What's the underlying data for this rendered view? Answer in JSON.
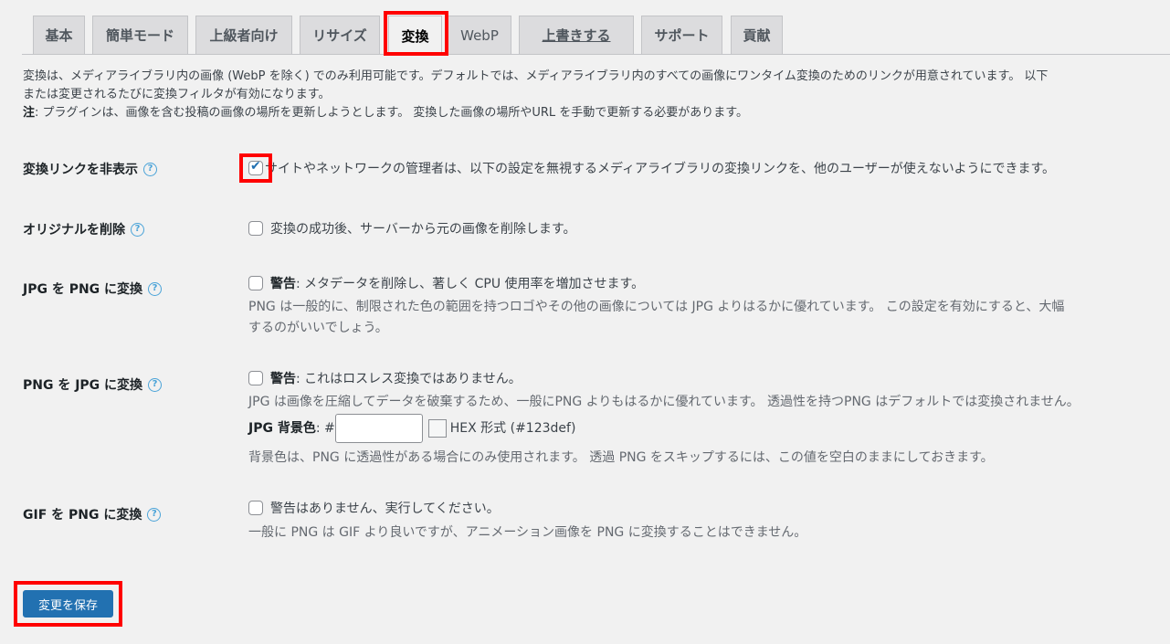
{
  "tabs": [
    {
      "label": "基本"
    },
    {
      "label": "簡単モード"
    },
    {
      "label": "上級者向け"
    },
    {
      "label": "リサイズ"
    },
    {
      "label": "変換"
    },
    {
      "label": "WebP"
    },
    {
      "label": "上書きする"
    },
    {
      "label": "サポート"
    },
    {
      "label": "貢献"
    }
  ],
  "description": {
    "line1": "変換は、メディアライブラリ内の画像 (WebP を除く) でのみ利用可能です。デフォルトでは、メディアライブラリ内のすべての画像にワンタイム変換のためのリンクが用意されています。 以下",
    "line2": "または変更されるたびに変換フィルタが有効になります。",
    "note_label": "注",
    "note_text": ": プラグインは、画像を含む投稿の画像の場所を更新しようとします。 変換した画像の場所やURL を手動で更新する必要があります。"
  },
  "settings": {
    "hide_links": {
      "label": "変換リンクを非表示",
      "checked": true,
      "text": "サイトやネットワークの管理者は、以下の設定を無視するメディアライブラリの変換リンクを、他のユーザーが使えないようにできます。"
    },
    "delete_original": {
      "label": "オリジナルを削除",
      "checked": false,
      "text": "変換の成功後、サーバーから元の画像を削除します。"
    },
    "jpg_to_png": {
      "label": "JPG を PNG に変換",
      "checked": false,
      "warning_label": "警告",
      "text": ": メタデータを削除し、著しく CPU 使用率を増加させます。",
      "note1": "PNG は一般的に、制限された色の範囲を持つロゴやその他の画像については JPG よりはるかに優れています。 この設定を有効にすると、大幅",
      "note2": "するのがいいでしょう。"
    },
    "png_to_jpg": {
      "label": "PNG を JPG に変換",
      "checked": false,
      "warning_label": "警告",
      "text": ": これはロスレス変換ではありません。",
      "note1": "JPG は画像を圧縮してデータを破棄するため、一般にPNG よりもはるかに優れています。 透過性を持つPNG はデフォルトでは変換されません。",
      "bg_label": "JPG 背景色",
      "bg_hash": ": #",
      "bg_value": "",
      "hex_hint": "HEX 形式 (#123def)",
      "note2": "背景色は、PNG に透過性がある場合にのみ使用されます。 透過 PNG をスキップするには、この値を空白のままにしておきます。"
    },
    "gif_to_png": {
      "label": "GIF を PNG に変換",
      "checked": false,
      "text": "警告はありません、実行してください。",
      "note1": "一般に PNG は GIF より良いですが、アニメーション画像を PNG に変換することはできません。"
    }
  },
  "save_button": {
    "label": "変更を保存"
  },
  "colors": {
    "accent": "#2271b1",
    "highlight": "#ff0000",
    "help_icon": "#4aa3d8"
  }
}
